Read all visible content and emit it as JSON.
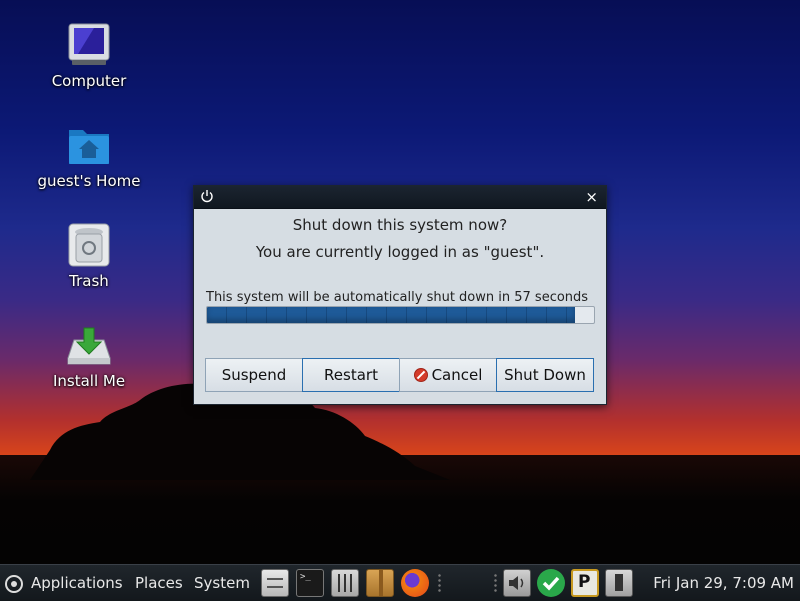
{
  "desktop": {
    "icons": [
      {
        "label": "Computer",
        "icon": "computer-icon"
      },
      {
        "label": "guest's Home",
        "icon": "home-folder-icon"
      },
      {
        "label": "Trash",
        "icon": "trash-icon"
      },
      {
        "label": "Install Me",
        "icon": "install-icon"
      }
    ]
  },
  "dialog": {
    "title_icon": "power-icon",
    "close_glyph": "×",
    "heading": "Shut down this system now?",
    "subheading": "You are currently logged in as \"guest\".",
    "countdown_message": "This system will be automatically shut down in 57 seconds",
    "progress_fraction": 0.95,
    "buttons": {
      "suspend": "Suspend",
      "restart": "Restart",
      "cancel": "Cancel",
      "shutdown": "Shut Down"
    }
  },
  "panel": {
    "menus": {
      "applications": "Applications",
      "places": "Places",
      "system": "System"
    },
    "launchers": [
      "file-manager-icon",
      "terminal-icon",
      "settings-mixer-icon",
      "archive-icon",
      "firefox-icon"
    ],
    "tray": [
      "volume-icon",
      "update-check-icon",
      "parcellite-icon",
      "battery-icon"
    ],
    "clock": "Fri Jan 29,  7:09 AM"
  },
  "colors": {
    "dialog_bg": "#d6dde3",
    "progress_fill": "#1e5a98",
    "panel_bg": "#1a1f24"
  }
}
